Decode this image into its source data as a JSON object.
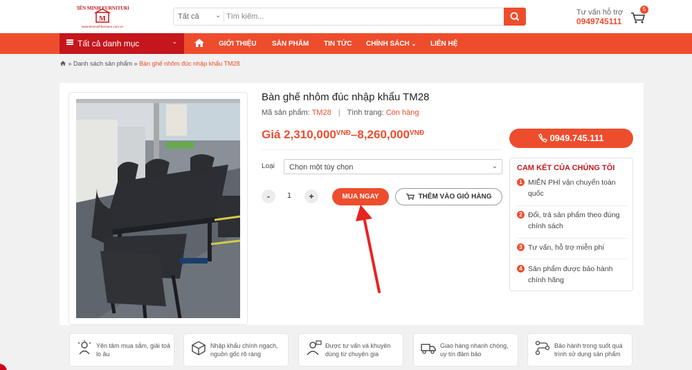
{
  "brand": {
    "logo_text": "TIẾN MINH FURNITURE",
    "logo_url_text": "www.tienminhfurniture.com.vn",
    "accent": "#ee4d2d",
    "dark_red": "#c4161c"
  },
  "search": {
    "category": "Tất cả",
    "placeholder": "Tìm kiếm..."
  },
  "hotline": {
    "label": "Tư vấn hỗ trợ",
    "number": "0949745111"
  },
  "cart": {
    "count": "5"
  },
  "nav": {
    "categories_label": "Tất cả danh mục",
    "items": [
      "GIỚI THIỆU",
      "SẢN PHẨM",
      "TIN TỨC",
      "CHÍNH SÁCH",
      "LIÊN HỆ"
    ]
  },
  "breadcrumb": {
    "items": [
      "Danh sách sản phẩm"
    ],
    "current": "Bàn ghế nhôm đúc nhập khẩu TM28"
  },
  "product": {
    "title": "Bàn ghế nhôm đúc nhập khẩu TM28",
    "sku_label": "Mã sản phẩm:",
    "sku": "TM28",
    "stock_label": "Tình trạng:",
    "stock": "Còn hàng",
    "price_prefix": "Giá",
    "price_min": "2,310,000",
    "price_max": "8,260,000",
    "currency": "VNĐ",
    "option_label": "Loại",
    "option_value": "Chọn một tùy chọn",
    "quantity": "1",
    "buy_label": "MUA NGAY",
    "add_cart_label": "THÊM VÀO GIỎ HÀNG"
  },
  "sidebar": {
    "phone": "0949.745.111",
    "commit_title": "CAM KẾT CỦA CHÚNG TÔI",
    "commitments": [
      {
        "n": "1",
        "text": "MIỄN PHÍ vận chuyển toàn quốc"
      },
      {
        "n": "2",
        "text": "Đổi, trả sản phẩm theo đúng chính sách"
      },
      {
        "n": "3",
        "text": "Tư vấn, hỗ trợ miễn phí"
      },
      {
        "n": "4",
        "text": "Sản phẩm được bảo hành chính hãng"
      }
    ]
  },
  "features": [
    {
      "icon": "shopping-icon",
      "text": "Yên tâm mua sắm, giải toả lo âu"
    },
    {
      "icon": "box-icon",
      "text": "Nhập khẩu chính ngạch, nguồn gốc rõ ràng"
    },
    {
      "icon": "consultant-icon",
      "text": "Được tư vấn và khuyên dùng từ chuyên gia"
    },
    {
      "icon": "delivery-icon",
      "text": "Giao hàng nhanh chóng, uy tín đảm bảo"
    },
    {
      "icon": "warranty-icon",
      "text": "Bảo hành trong suốt quá trình sử dụng sản phẩm"
    }
  ]
}
